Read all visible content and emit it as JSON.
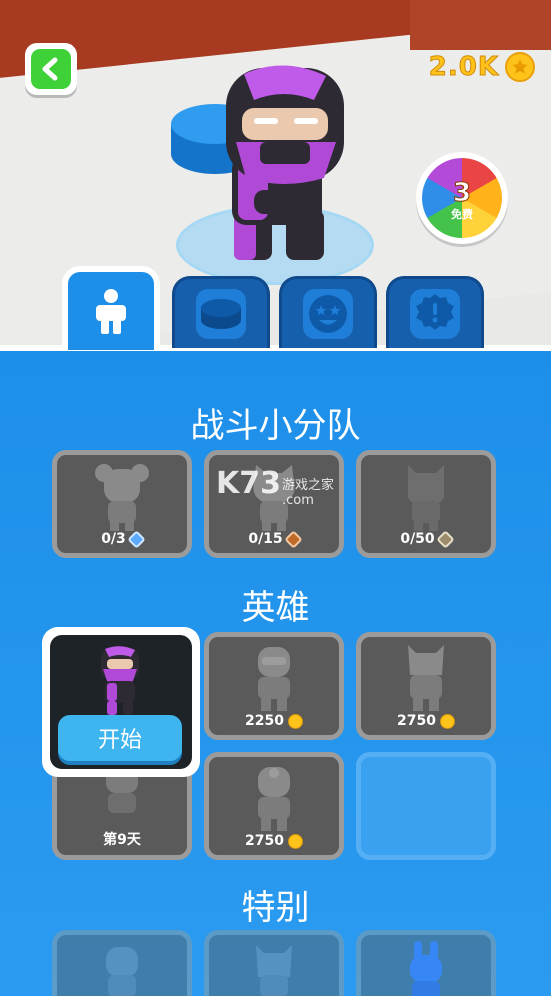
{
  "header": {
    "back_icon": "chevron-left-icon",
    "coin_amount": "2.0K",
    "coin_icon": "star-coin-icon",
    "spin": {
      "count": "3",
      "label": "免费"
    }
  },
  "tabs": [
    {
      "name": "characters",
      "icon": "person-icon",
      "active": true
    },
    {
      "name": "platforms",
      "icon": "disc-icon",
      "active": false
    },
    {
      "name": "emotes",
      "icon": "star-eyes-face-icon",
      "active": false
    },
    {
      "name": "badges",
      "icon": "ribbon-badge-icon",
      "active": false
    }
  ],
  "sections": {
    "squad": {
      "title": "战斗小分队",
      "cards": [
        {
          "progress": "0/3",
          "gem_color": "#5aa9ff"
        },
        {
          "progress": "0/15",
          "gem_color": "#c06a2a"
        },
        {
          "progress": "0/50",
          "gem_color": "#9b8b6a"
        }
      ]
    },
    "heroes": {
      "title": "英雄",
      "selected": {
        "button": "开始"
      },
      "cards": [
        {
          "price": "2250"
        },
        {
          "price": "2750"
        },
        {
          "day": "第9天"
        },
        {
          "price": "2750"
        }
      ]
    },
    "special": {
      "title": "特别"
    }
  },
  "watermark": {
    "main": "K73",
    "sub": "游戏之家",
    "domain": ".com"
  },
  "colors": {
    "background": "#1e8fe9",
    "coin": "#ffc21a",
    "green": "#3fd238",
    "card": "#5a5a5a"
  }
}
